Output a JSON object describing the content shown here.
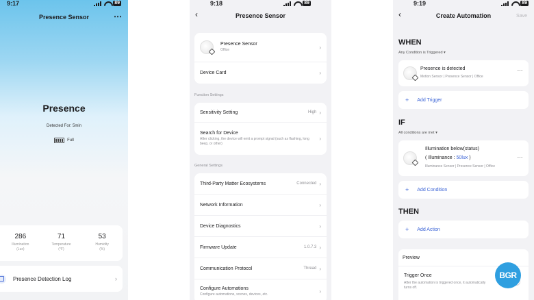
{
  "screen1": {
    "time": "9:17",
    "battery": "89",
    "title": "Presence Sensor",
    "more": "⋯",
    "state": "Presence",
    "detected_for": "Detected For: 5min",
    "battery_label": "Full",
    "stats": [
      {
        "value": "286",
        "label": "Illumination",
        "unit": "(Lux)"
      },
      {
        "value": "71",
        "label": "Temperature",
        "unit": "(°F)"
      },
      {
        "value": "53",
        "label": "Humidity",
        "unit": "(%)"
      }
    ],
    "log_label": "Presence Detection Log"
  },
  "screen2": {
    "time": "9:18",
    "battery": "89",
    "title": "Presence Sensor",
    "device": {
      "name": "Presence Sensor",
      "room": "Office"
    },
    "device_card": "Device Card",
    "function_settings_label": "Function Settings",
    "sensitivity": {
      "label": "Sensitivity Setting",
      "value": "High"
    },
    "search": {
      "label": "Search for Device",
      "desc": "After clicking, the device will emit a prompt signal (such as flashing, long beep, or other)"
    },
    "general_settings_label": "General Settings",
    "general": [
      {
        "label": "Third-Party Matter Ecosystems",
        "value": "Connected"
      },
      {
        "label": "Network Information",
        "value": ""
      },
      {
        "label": "Device Diagnostics",
        "value": ""
      },
      {
        "label": "Firmware Update",
        "value": "1.0.7.3"
      },
      {
        "label": "Communication Protocol",
        "value": "Thread"
      }
    ],
    "configure": {
      "label": "Configure Automations",
      "desc": "Configure automations, scenes, devices, etc."
    }
  },
  "screen3": {
    "time": "9:19",
    "battery": "89",
    "title": "Create Automation",
    "save": "Save",
    "when": "WHEN",
    "when_cond": "Any Condition is Triggered ▾",
    "trigger": {
      "title": "Presence is detected",
      "sub": "Motion Sensor | Presence Sensor | Office"
    },
    "add_trigger": "Add Trigger",
    "if": "IF",
    "if_cond": "All conditions are met ▾",
    "condition": {
      "title": "Illumination below(status)",
      "detail_prefix": "( Illuminance : ",
      "detail_value": "50lux",
      "detail_suffix": " )",
      "sub": "Illuminance Sensor | Presence Sensor | Office"
    },
    "add_condition": "Add Condition",
    "then": "THEN",
    "add_action": "Add Action",
    "preview": "Preview",
    "trigger_once": {
      "title": "Trigger Once",
      "desc": "After the automation is triggered once, it automatically turns off."
    }
  },
  "watermark": "BGR",
  "colors": {
    "accent": "#3a63d6",
    "watermark": "#2f9fe0"
  }
}
